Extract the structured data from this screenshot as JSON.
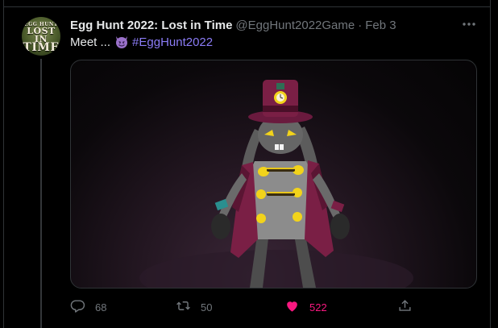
{
  "tweet": {
    "display_name": "Egg Hunt 2022: Lost in Time",
    "handle": "@EggHunt2022Game",
    "separator": "·",
    "date": "Feb 3",
    "text_prefix": "Meet ...",
    "emoji": "smiling-imp-emoji",
    "hashtag": "#EggHunt2022",
    "avatar_logo": {
      "line1": "EGG HUNT",
      "line2": "LOST IN",
      "line3": "TIME"
    }
  },
  "actions": {
    "reply_count": "68",
    "retweet_count": "50",
    "like_count": "522",
    "like_active": true
  },
  "colors": {
    "background": "#000000",
    "text_primary": "#e7e9ea",
    "text_secondary": "#71767b",
    "hashtag": "#8b7cf6",
    "like_active": "#f91880"
  },
  "icons": {
    "more": "more-horizontal-icon",
    "reply": "reply-icon",
    "retweet": "retweet-icon",
    "like": "heart-filled-icon",
    "share": "share-icon"
  }
}
